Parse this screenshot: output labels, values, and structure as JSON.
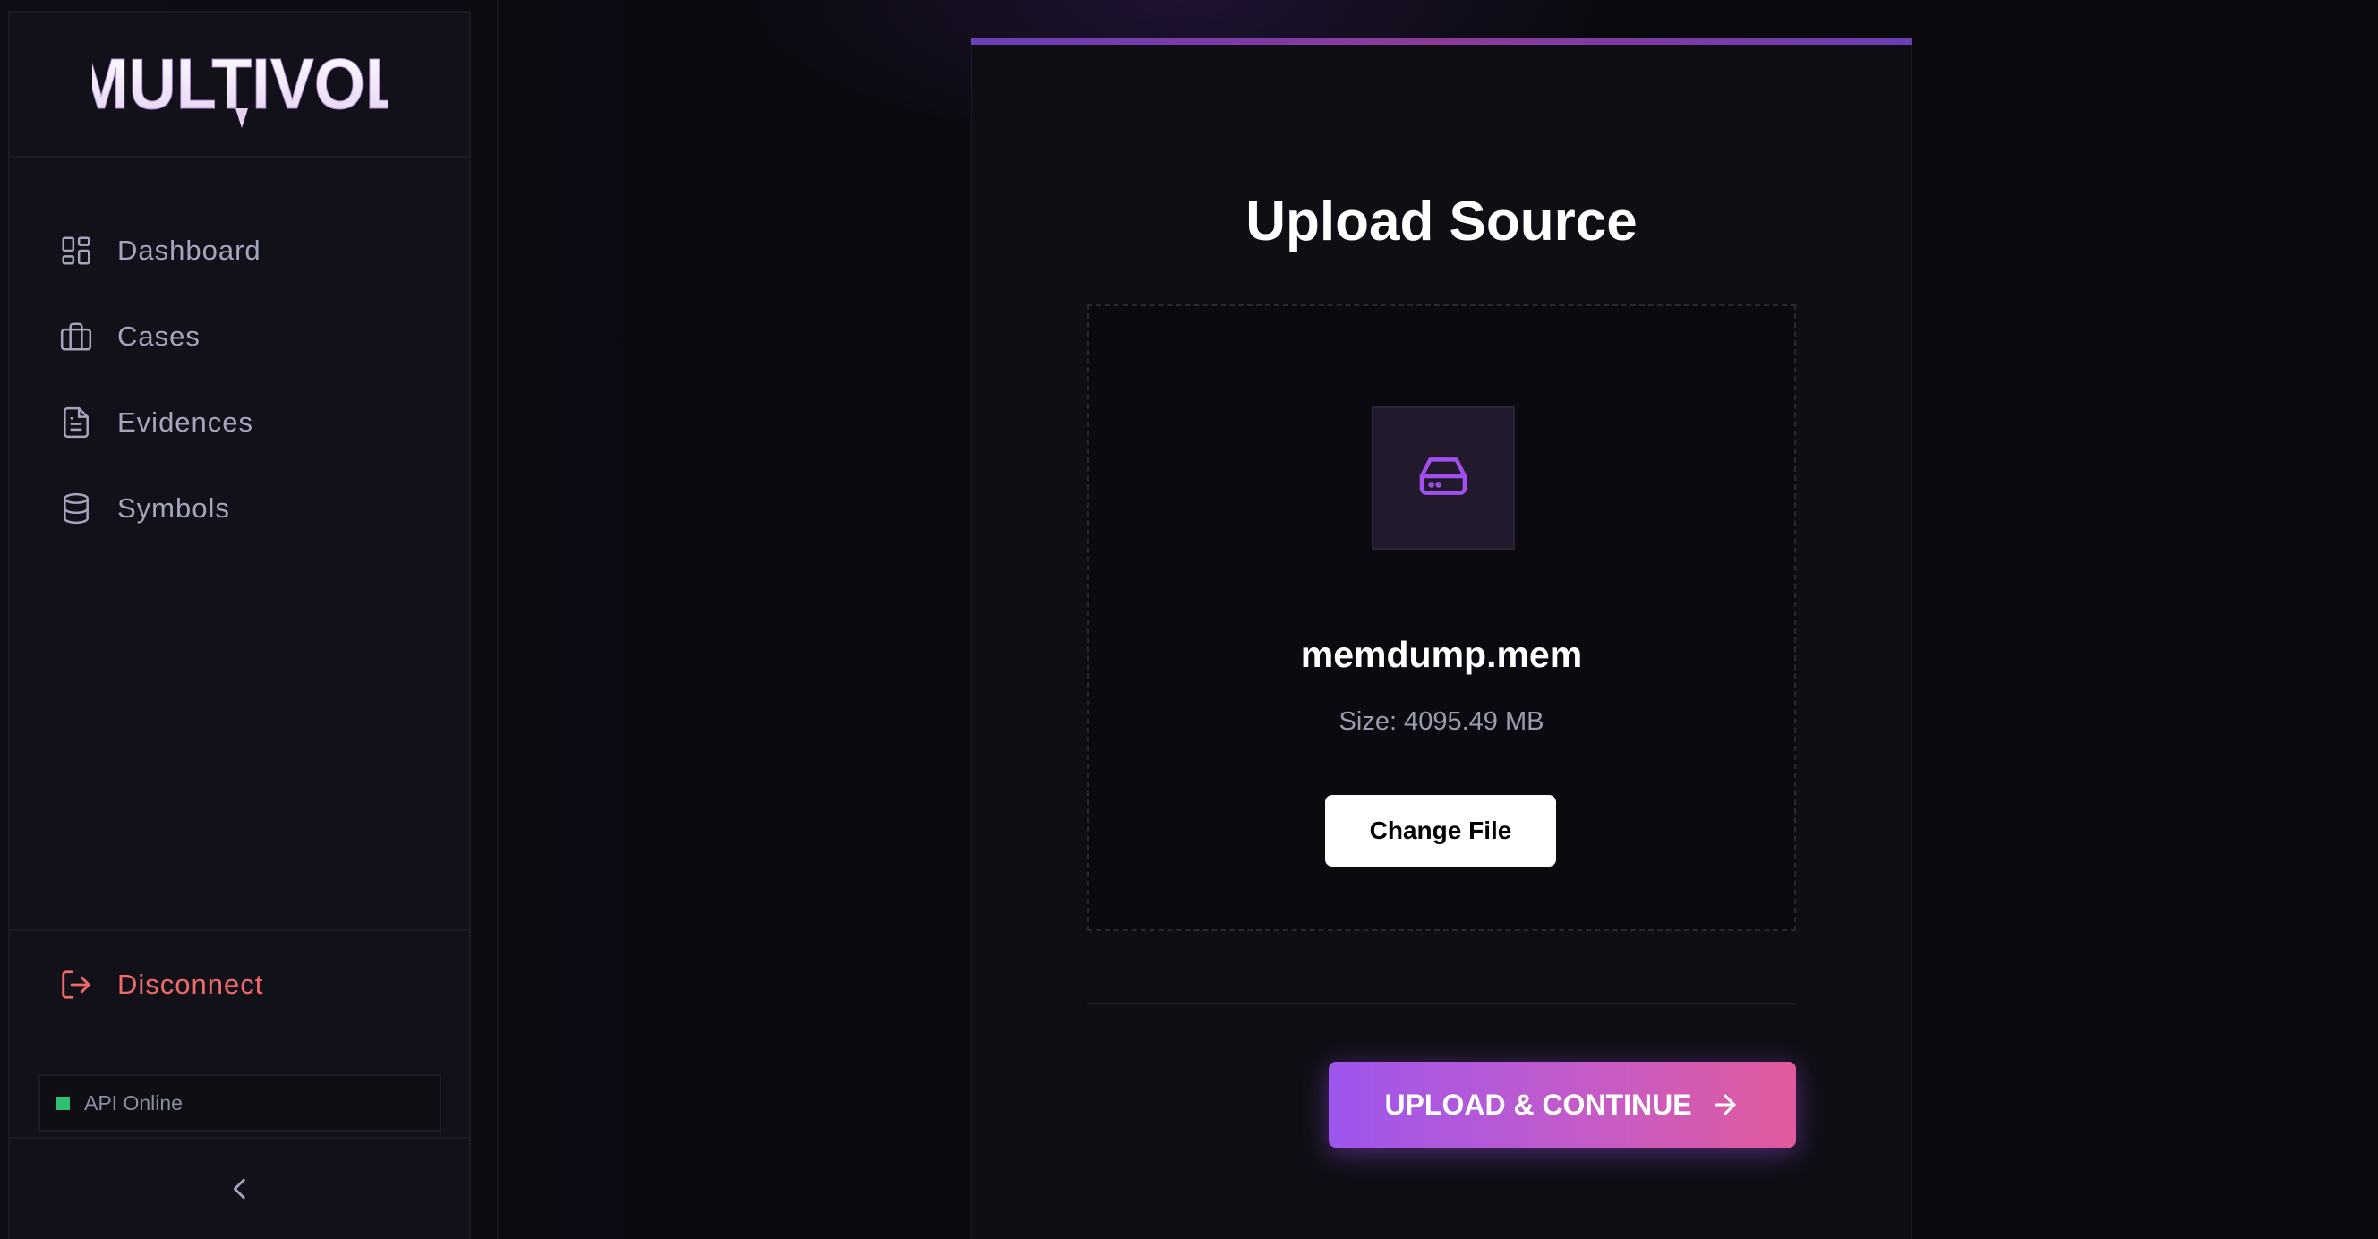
{
  "sidebar": {
    "logo_text": "MULTIVOL",
    "items": [
      {
        "label": "Dashboard",
        "icon": "dashboard-grid-icon"
      },
      {
        "label": "Cases",
        "icon": "briefcase-icon"
      },
      {
        "label": "Evidences",
        "icon": "document-icon"
      },
      {
        "label": "Symbols",
        "icon": "database-icon"
      }
    ],
    "disconnect_label": "Disconnect",
    "api_status": "API Online",
    "collapse_icon": "chevron-left-icon"
  },
  "colors": {
    "accent_purple": "#9d56ee",
    "accent_pink": "#e15a9b",
    "danger": "#f06a6a",
    "status_online": "#2fbf71"
  },
  "upload": {
    "title": "Upload Source",
    "file_icon": "hard-drive-icon",
    "file_name": "memdump.mem",
    "file_size": "Size: 4095.49 MB",
    "change_file_label": "Change File",
    "upload_label": "UPLOAD & CONTINUE",
    "upload_icon": "arrow-right-icon"
  }
}
